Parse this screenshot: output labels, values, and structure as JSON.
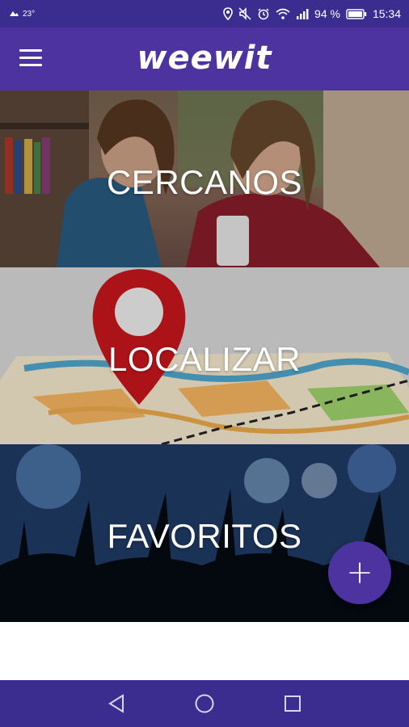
{
  "status_bar": {
    "temperature": "23°",
    "battery_percent": "94 %",
    "time": "15:34",
    "icons": [
      "weather-icon",
      "location-icon",
      "mute-icon",
      "alarm-icon",
      "wifi-icon",
      "signal-icon",
      "battery-icon"
    ]
  },
  "app_bar": {
    "brand": "weewit",
    "menu_icon": "hamburger-menu-icon"
  },
  "tiles": [
    {
      "label": "CERCANOS"
    },
    {
      "label": "LOCALIZAR"
    },
    {
      "label": "FAVORITOS"
    }
  ],
  "fab": {
    "icon": "plus-icon",
    "symbol": "+"
  },
  "nav_bar": {
    "icons": [
      "back-icon",
      "home-icon",
      "recents-icon"
    ]
  },
  "colors": {
    "primary": "#4c33a0",
    "primary_dark": "#3b2c8f",
    "pin_red": "#c4161c"
  }
}
